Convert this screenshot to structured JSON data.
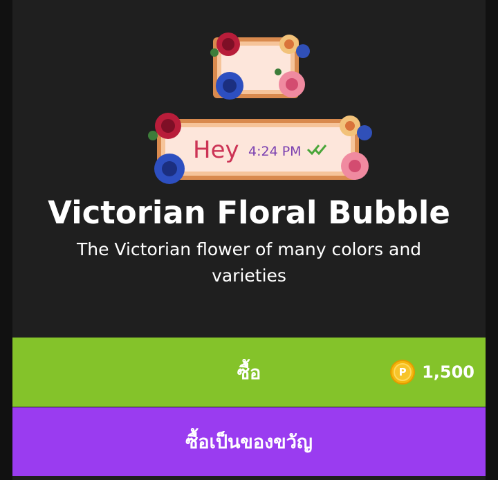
{
  "item": {
    "title": "Victorian Floral Bubble",
    "description": "The Victorian flower of many colors and varieties"
  },
  "preview": {
    "sample_message": "Hey",
    "sample_time": "4:24 PM"
  },
  "buy_button": {
    "label": "ซื้อ",
    "price": "1,500",
    "coin_symbol": "P"
  },
  "gift_button": {
    "label": "ซื้อเป็นของขวัญ"
  },
  "colors": {
    "buy_green": "#84c32a",
    "gift_purple": "#9a3cf0",
    "coin_gold": "#f5b70f"
  }
}
